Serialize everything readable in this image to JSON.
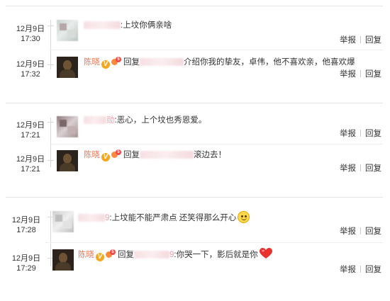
{
  "actions": {
    "report": "举报",
    "reply": "回复"
  },
  "reply_prefix": "回复",
  "threads": [
    {
      "comment": {
        "date": "12月9日",
        "time": "17:30",
        "text": ":上坟你俩亲啥"
      },
      "reply": {
        "date": "12月9日",
        "time": "17:32",
        "username": "陈晓",
        "text": "介绍你我的挚友，卓伟，他不喜欢亲，他喜欢爆"
      }
    },
    {
      "comment": {
        "date": "12月9日",
        "time": "17:21",
        "name_suffix": "勋",
        "text": ":恶心，上个坟也秀恩爱。"
      },
      "reply": {
        "date": "12月9日",
        "time": "17:21",
        "username": "陈晓",
        "text": "滚边去！"
      }
    },
    {
      "comment": {
        "date": "12月9日",
        "time": "17:28",
        "name_suffix": "9",
        "text": ":上坟能不能严肃点 还笑得那么开心"
      },
      "reply": {
        "date": "12月9日",
        "time": "17:29",
        "username": "陈晓",
        "name_suffix": "9",
        "text": ":你哭一下，影后就是你"
      }
    }
  ]
}
